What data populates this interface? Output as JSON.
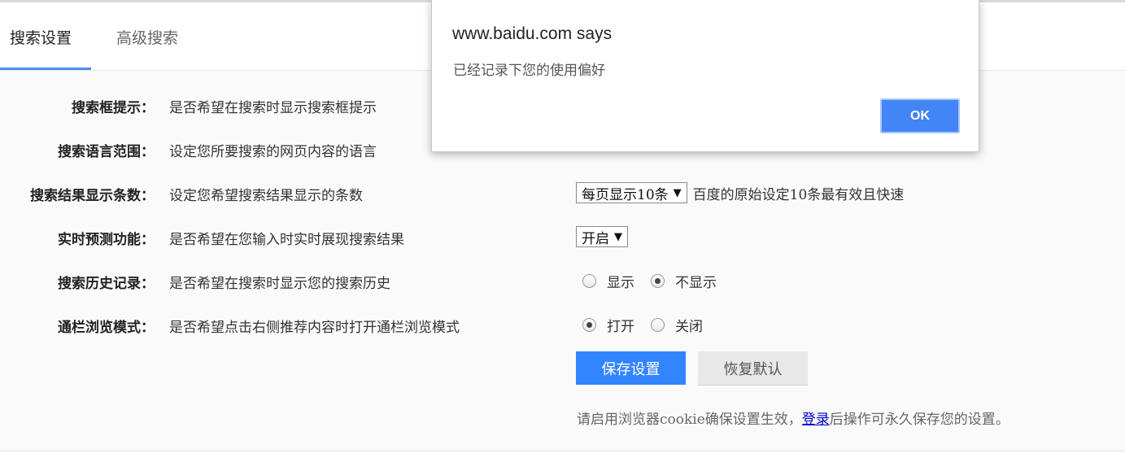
{
  "tabs": {
    "active_label": "搜索设置",
    "inactive_label": "高级搜索"
  },
  "rows": [
    {
      "label": "搜索框提示：",
      "desc": "是否希望在搜索时显示搜索框提示"
    },
    {
      "label": "搜索语言范围：",
      "desc": "设定您所要搜索的网页内容的语言"
    },
    {
      "label": "搜索结果显示条数：",
      "desc": "设定您希望搜索结果显示的条数"
    },
    {
      "label": "实时预测功能：",
      "desc": "是否希望在您输入时实时展现搜索结果"
    },
    {
      "label": "搜索历史记录：",
      "desc": "是否希望在搜索时显示您的搜索历史"
    },
    {
      "label": "通栏浏览模式：",
      "desc": "是否希望点击右侧推荐内容时打开通栏浏览模式"
    }
  ],
  "results_count": {
    "selected": "每页显示10条",
    "note": "百度的原始设定10条最有效且快速"
  },
  "realtime": {
    "selected": "开启"
  },
  "history": {
    "option_show": "显示",
    "option_hide": "不显示"
  },
  "fullbar": {
    "option_open": "打开",
    "option_close": "关闭"
  },
  "buttons": {
    "save": "保存设置",
    "reset": "恢复默认"
  },
  "hint": {
    "before": "请启用浏览器cookie确保设置生效，",
    "link": "登录",
    "after": "后操作可永久保存您的设置。"
  },
  "dialog": {
    "title": "www.baidu.com says",
    "message": "已经记录下您的使用偏好",
    "ok": "OK"
  },
  "colors": {
    "primary_blue": "#3385ff",
    "tab_underline": "#4a8ef0",
    "dialog_ok": "#4285f4",
    "link": "#0000cc"
  }
}
